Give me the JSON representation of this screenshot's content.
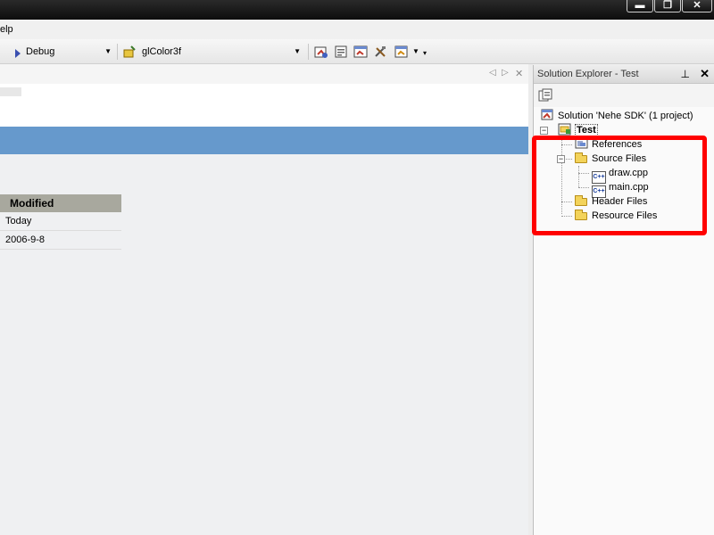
{
  "window": {
    "minimize": "▬",
    "maximize": "❐",
    "close": "✕"
  },
  "menu": {
    "help_label": "elp"
  },
  "toolbar": {
    "config_value": "Debug",
    "find_value": "glColor3f",
    "icons": [
      "solution-properties-icon",
      "properties-icon",
      "object-browser-icon",
      "toolbox-icon",
      "class-view-icon"
    ]
  },
  "document": {
    "column_header": "Modified",
    "rows": [
      "Today",
      "2006-9-8"
    ],
    "band_color": "#6699cc"
  },
  "solution_explorer": {
    "title": "Solution Explorer - Test",
    "pin": "⊥",
    "close": "✕",
    "solution": "Solution 'Nehe SDK' (1 project)",
    "project": "Test",
    "items": [
      {
        "label": "References"
      },
      {
        "label": "Source Files"
      },
      {
        "label": "draw.cpp"
      },
      {
        "label": "main.cpp"
      },
      {
        "label": "Header Files"
      },
      {
        "label": "Resource Files"
      }
    ],
    "highlight_color": "#ff0000"
  }
}
